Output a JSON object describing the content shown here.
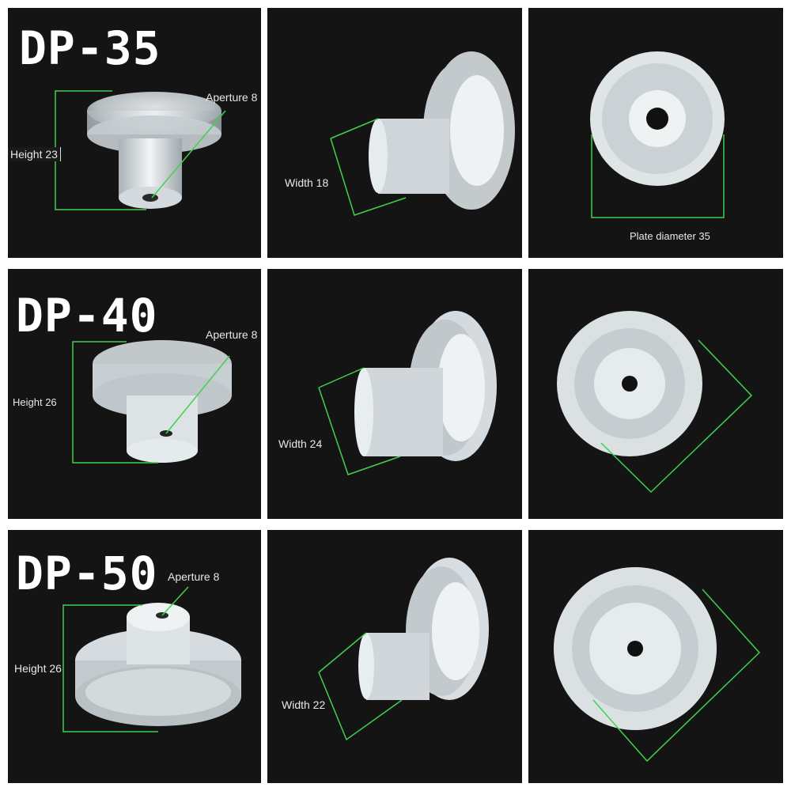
{
  "rows": [
    {
      "model": "DP-35",
      "height_label": "Height 23",
      "aperture_label": "Aperture 8",
      "width_label": "Width 18",
      "plate_label": "Plate diameter 35"
    },
    {
      "model": "DP-40",
      "height_label": "Height 26",
      "aperture_label": "Aperture 8",
      "width_label": "Width 24"
    },
    {
      "model": "DP-50",
      "height_label": "Height 26",
      "aperture_label": "Aperture 8",
      "width_label": "Width 22"
    }
  ],
  "colors": {
    "background": "#141414",
    "measure_line": "#3fd24a",
    "silicone": "#e9eef0"
  }
}
